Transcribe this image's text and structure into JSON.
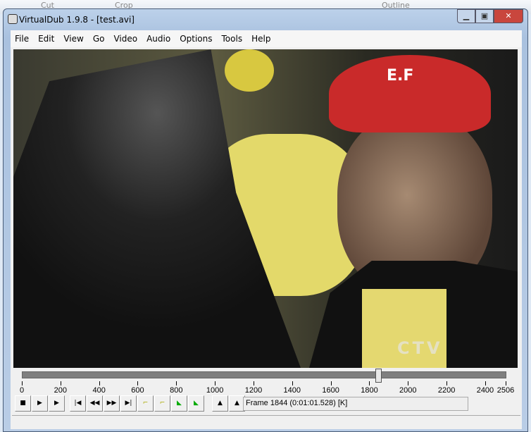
{
  "background_app": {
    "cut": "Cut",
    "crop": "Crop",
    "outline": "Outline"
  },
  "window": {
    "title": "VirtualDub 1.9.8 - [test.avi]"
  },
  "menu": [
    "File",
    "Edit",
    "View",
    "Go",
    "Video",
    "Audio",
    "Options",
    "Tools",
    "Help"
  ],
  "video": {
    "watermark": "CTV",
    "cap_text": "E.F"
  },
  "timeline": {
    "min": 0,
    "max": 2506,
    "position": 1844,
    "ticks": [
      0,
      200,
      400,
      600,
      800,
      1000,
      1200,
      1400,
      1600,
      1800,
      2000,
      2200,
      2400,
      2506
    ]
  },
  "toolbar": {
    "buttons": [
      "stop",
      "play-input",
      "play-output",
      "start",
      "prev-key",
      "next-key",
      "end",
      "prev-keyframe",
      "next-keyframe",
      "prev-scene",
      "next-scene",
      "mark-in",
      "mark-out"
    ]
  },
  "frame_info": "Frame 1844 (0:01:01.528) [K]"
}
